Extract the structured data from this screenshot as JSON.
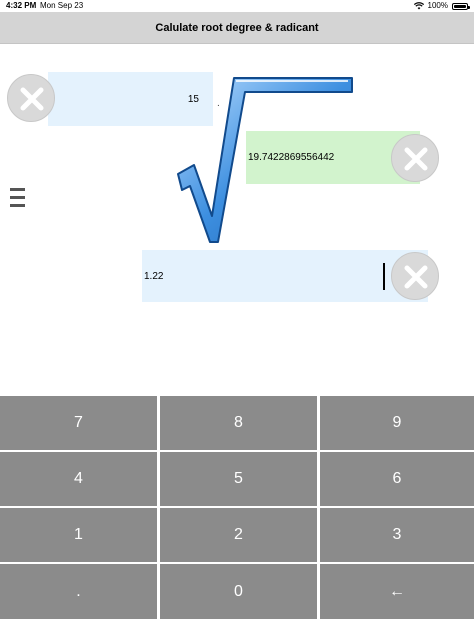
{
  "status_bar": {
    "time": "4:32 PM",
    "date": "Mon Sep 23",
    "battery": "100%"
  },
  "nav": {
    "title": "Calulate root degree & radicant"
  },
  "fields": {
    "degree_value": "15",
    "dot_mark": ".",
    "result_value": "19.7422869556442",
    "radicand_value": "1.22"
  },
  "keypad": {
    "keys": [
      "7",
      "8",
      "9",
      "4",
      "5",
      "6",
      "1",
      "2",
      "3",
      ".",
      "0",
      "←"
    ]
  },
  "colors": {
    "nav_background": "#d4d4d4",
    "input_background": "#e4f2fd",
    "result_background": "#d2f3cd",
    "key_background": "#8b8b8b",
    "root_sign": "#2d7fd0"
  }
}
